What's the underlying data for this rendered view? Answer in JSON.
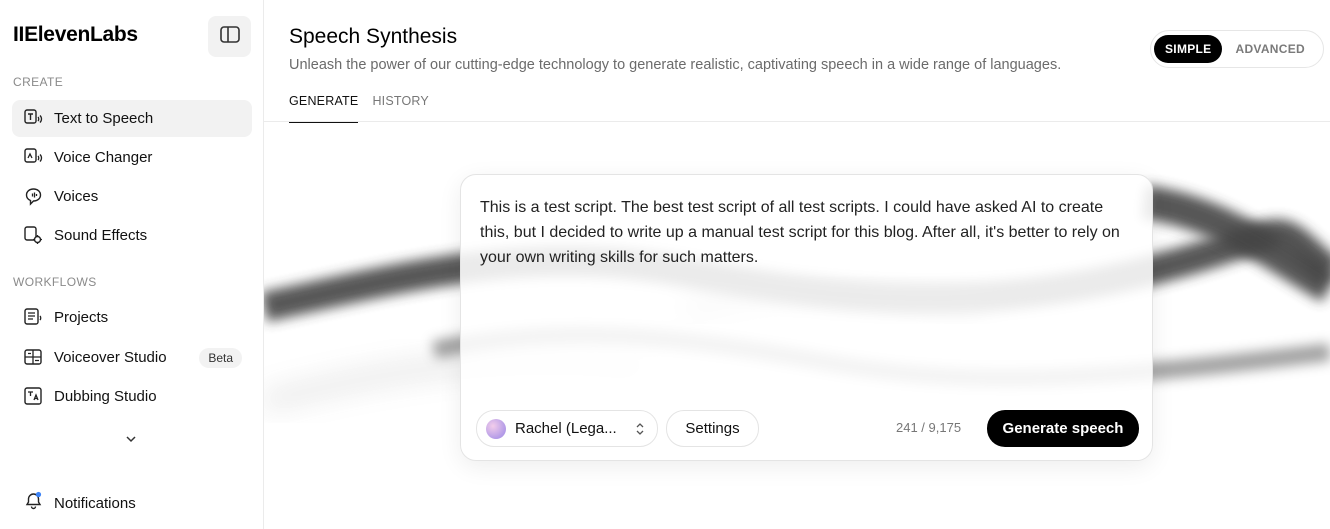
{
  "brand": {
    "logo": "IIElevenLabs"
  },
  "sidebar": {
    "sections": [
      {
        "label": "CREATE"
      },
      {
        "label": "WORKFLOWS"
      }
    ],
    "items": [
      {
        "label": "Text to Speech",
        "icon": "text-to-speech-icon",
        "active": true
      },
      {
        "label": "Voice Changer",
        "icon": "voice-changer-icon"
      },
      {
        "label": "Voices",
        "icon": "voices-icon"
      },
      {
        "label": "Sound Effects",
        "icon": "sound-effects-icon"
      },
      {
        "label": "Projects",
        "icon": "projects-icon"
      },
      {
        "label": "Voiceover Studio",
        "icon": "voiceover-studio-icon",
        "badge": "Beta"
      },
      {
        "label": "Dubbing Studio",
        "icon": "dubbing-studio-icon"
      }
    ],
    "notifications_label": "Notifications"
  },
  "header": {
    "title": "Speech Synthesis",
    "subtitle": "Unleash the power of our cutting-edge technology to generate realistic, captivating speech in a wide range of languages.",
    "mode": {
      "simple": "SIMPLE",
      "advanced": "ADVANCED",
      "selected": "SIMPLE"
    },
    "tabs": [
      {
        "label": "GENERATE",
        "active": true
      },
      {
        "label": "HISTORY",
        "active": false
      }
    ]
  },
  "editor": {
    "script_text": "This is a test script. The best test script of all test scripts. I could have asked AI to create this, but I decided to write up a manual test script for this blog. After all, it's better to rely on your own writing skills for such matters.",
    "voice": "Rachel (Lega...",
    "settings_label": "Settings",
    "char_count": "241 / 9,175",
    "generate_label": "Generate speech"
  },
  "colors": {
    "accent": "#000000",
    "active_nav_bg": "#f2f2f2",
    "notification_dot": "#3b82f6"
  }
}
